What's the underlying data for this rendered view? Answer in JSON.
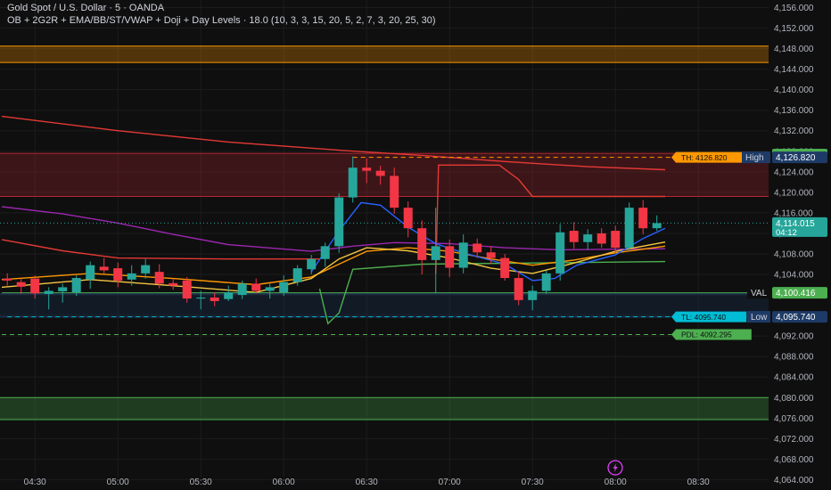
{
  "header": {
    "title": "Gold Spot / U.S. Dollar · 5 · OANDA",
    "indicators": "OB + 2G2R + EMA/BB/ST/VWAP + Doji + Day Levels · 18.0 (10, 3, 3, 15, 20, 5, 2, 7, 3, 20, 25, 30)"
  },
  "colors": {
    "background": "#0f0f0f",
    "bull": "#26a69a",
    "bear": "#f23645",
    "ema_blue": "#2962ff",
    "ema_yellow": "#f5c542",
    "ema_orange": "#ff9800",
    "purple": "#9c27b0",
    "zone_orange": "#ff9800",
    "zone_red": "#b22833",
    "zone_green": "#4caf50",
    "zone_blue": "#1e3a66",
    "supertrend_red": "#e53935",
    "supertrend_green": "#4caf50"
  },
  "chart_data": {
    "type": "candlestick",
    "symbol": "Gold Spot / U.S. Dollar",
    "interval": "5",
    "source": "OANDA",
    "y_axis": {
      "min": 4062,
      "max": 4157,
      "ticks": [
        4156,
        4152,
        4148,
        4144,
        4140,
        4136,
        4132,
        4128,
        4124,
        4120,
        4116,
        4112,
        4108,
        4104,
        4100,
        4096,
        4092,
        4088,
        4084,
        4080,
        4076,
        4072,
        4068,
        4064
      ]
    },
    "x_axis": {
      "labels": [
        {
          "label": "04:30",
          "t": 30
        },
        {
          "label": "05:00",
          "t": 60
        },
        {
          "label": "05:30",
          "t": 90
        },
        {
          "label": "06:00",
          "t": 120
        },
        {
          "label": "06:30",
          "t": 150
        },
        {
          "label": "07:00",
          "t": 180
        },
        {
          "label": "07:30",
          "t": 210
        },
        {
          "label": "08:00",
          "t": 240
        },
        {
          "label": "08:30",
          "t": 270
        }
      ],
      "t_range": [
        18,
        283
      ],
      "unit": "minutes after 04:00"
    },
    "candles": [
      {
        "t": 20,
        "o": 4103.2,
        "h": 4104.2,
        "l": 4101.8,
        "c": 4102.8
      },
      {
        "t": 25,
        "o": 4102.5,
        "h": 4103.2,
        "l": 4100.2,
        "c": 4101.6
      },
      {
        "t": 30,
        "o": 4103.2,
        "h": 4103.8,
        "l": 4099.3,
        "c": 4100.3
      },
      {
        "t": 35,
        "o": 4100.2,
        "h": 4101.5,
        "l": 4097.2,
        "c": 4100.8
      },
      {
        "t": 40,
        "o": 4100.7,
        "h": 4102.2,
        "l": 4098.5,
        "c": 4101.5
      },
      {
        "t": 45,
        "o": 4100.5,
        "h": 4103.8,
        "l": 4099.8,
        "c": 4103.3
      },
      {
        "t": 50,
        "o": 4103.0,
        "h": 4106.5,
        "l": 4101.2,
        "c": 4105.8
      },
      {
        "t": 55,
        "o": 4105.5,
        "h": 4107.2,
        "l": 4104.2,
        "c": 4104.8
      },
      {
        "t": 60,
        "o": 4105.2,
        "h": 4106.3,
        "l": 4101.5,
        "c": 4102.8
      },
      {
        "t": 65,
        "o": 4103.0,
        "h": 4105.8,
        "l": 4101.8,
        "c": 4104.2
      },
      {
        "t": 70,
        "o": 4104.2,
        "h": 4107.0,
        "l": 4103.2,
        "c": 4105.8
      },
      {
        "t": 75,
        "o": 4104.5,
        "h": 4106.0,
        "l": 4101.3,
        "c": 4102.2
      },
      {
        "t": 80,
        "o": 4102.3,
        "h": 4103.2,
        "l": 4101.0,
        "c": 4101.8
      },
      {
        "t": 85,
        "o": 4102.8,
        "h": 4103.5,
        "l": 4098.5,
        "c": 4099.3
      },
      {
        "t": 90,
        "o": 4099.3,
        "h": 4100.8,
        "l": 4097.2,
        "c": 4099.5
      },
      {
        "t": 95,
        "o": 4099.5,
        "h": 4100.5,
        "l": 4097.8,
        "c": 4098.8
      },
      {
        "t": 100,
        "o": 4099.2,
        "h": 4101.8,
        "l": 4098.8,
        "c": 4100.5
      },
      {
        "t": 105,
        "o": 4100.0,
        "h": 4102.8,
        "l": 4099.2,
        "c": 4102.2
      },
      {
        "t": 110,
        "o": 4102.2,
        "h": 4103.2,
        "l": 4100.3,
        "c": 4100.8
      },
      {
        "t": 115,
        "o": 4100.8,
        "h": 4102.2,
        "l": 4099.3,
        "c": 4101.5
      },
      {
        "t": 120,
        "o": 4100.5,
        "h": 4103.8,
        "l": 4099.8,
        "c": 4102.5
      },
      {
        "t": 125,
        "o": 4102.5,
        "h": 4105.8,
        "l": 4101.8,
        "c": 4105.2
      },
      {
        "t": 130,
        "o": 4105.0,
        "h": 4107.8,
        "l": 4104.0,
        "c": 4107.0
      },
      {
        "t": 135,
        "o": 4107.0,
        "h": 4110.2,
        "l": 4105.5,
        "c": 4109.5
      },
      {
        "t": 140,
        "o": 4109.5,
        "h": 4119.8,
        "l": 4108.2,
        "c": 4119.0
      },
      {
        "t": 145,
        "o": 4119.0,
        "h": 4127.0,
        "l": 4118.0,
        "c": 4124.8
      },
      {
        "t": 150,
        "o": 4124.8,
        "h": 4126.6,
        "l": 4121.8,
        "c": 4124.2
      },
      {
        "t": 155,
        "o": 4124.2,
        "h": 4125.2,
        "l": 4121.5,
        "c": 4123.2
      },
      {
        "t": 160,
        "o": 4123.2,
        "h": 4124.8,
        "l": 4115.8,
        "c": 4117.0
      },
      {
        "t": 165,
        "o": 4117.0,
        "h": 4118.2,
        "l": 4111.2,
        "c": 4113.0
      },
      {
        "t": 170,
        "o": 4113.0,
        "h": 4114.5,
        "l": 4104.0,
        "c": 4106.8
      },
      {
        "t": 175,
        "o": 4106.8,
        "h": 4117.0,
        "l": 4100.3,
        "c": 4109.5
      },
      {
        "t": 180,
        "o": 4109.5,
        "h": 4110.8,
        "l": 4103.5,
        "c": 4105.3
      },
      {
        "t": 185,
        "o": 4105.3,
        "h": 4111.8,
        "l": 4104.2,
        "c": 4110.2
      },
      {
        "t": 190,
        "o": 4110.0,
        "h": 4111.0,
        "l": 4107.2,
        "c": 4108.3
      },
      {
        "t": 195,
        "o": 4108.3,
        "h": 4109.5,
        "l": 4106.0,
        "c": 4107.2
      },
      {
        "t": 200,
        "o": 4107.2,
        "h": 4108.0,
        "l": 4102.8,
        "c": 4103.3
      },
      {
        "t": 205,
        "o": 4103.3,
        "h": 4104.5,
        "l": 4098.0,
        "c": 4099.0
      },
      {
        "t": 210,
        "o": 4099.0,
        "h": 4101.8,
        "l": 4097.0,
        "c": 4100.8
      },
      {
        "t": 215,
        "o": 4100.8,
        "h": 4104.8,
        "l": 4100.2,
        "c": 4104.2
      },
      {
        "t": 220,
        "o": 4104.2,
        "h": 4113.8,
        "l": 4102.8,
        "c": 4112.2
      },
      {
        "t": 225,
        "o": 4112.5,
        "h": 4114.2,
        "l": 4109.0,
        "c": 4110.3
      },
      {
        "t": 230,
        "o": 4110.3,
        "h": 4112.8,
        "l": 4108.8,
        "c": 4111.8
      },
      {
        "t": 235,
        "o": 4112.0,
        "h": 4113.0,
        "l": 4109.2,
        "c": 4110.0
      },
      {
        "t": 240,
        "o": 4112.5,
        "h": 4113.5,
        "l": 4108.2,
        "c": 4109.2
      },
      {
        "t": 245,
        "o": 4109.2,
        "h": 4118.0,
        "l": 4108.5,
        "c": 4117.0
      },
      {
        "t": 250,
        "o": 4117.0,
        "h": 4118.5,
        "l": 4111.8,
        "c": 4113.0
      },
      {
        "t": 255,
        "o": 4113.0,
        "h": 4115.5,
        "l": 4112.5,
        "c": 4114.0
      }
    ],
    "zones": [
      {
        "name": "orange-zone-top",
        "from": 4145.3,
        "to": 4148.5,
        "color": "#ff9800"
      },
      {
        "name": "red-zone",
        "from": 4119.2,
        "to": 4127.6,
        "color": "#b22833"
      },
      {
        "name": "blue-zone",
        "from": 4095.7,
        "to": 4100.2,
        "color": "#1e3a66"
      },
      {
        "name": "green-zone-bottom",
        "from": 4075.7,
        "to": 4080.0,
        "color": "#4caf50"
      }
    ],
    "levels": [
      {
        "name": "high-line",
        "value": 4126.82,
        "color": "#ff9800",
        "dashed": true,
        "t_start": 145,
        "label": "TH: 4126.820",
        "label_color": "#ff9800"
      },
      {
        "name": "tl-line",
        "value": 4095.74,
        "color": "#00bcd4",
        "dashed": true,
        "t_start": 20,
        "label": "TL: 4095.740",
        "label_color": "#00bcd4"
      },
      {
        "name": "pdl-line",
        "value": 4092.295,
        "color": "#4caf50",
        "dashed": true,
        "t_start": 18,
        "label": "PDL: 4092.295",
        "label_color": "#4caf50"
      },
      {
        "name": "val-line",
        "value": 4100.416,
        "color": "#4caf50",
        "dashed": false,
        "t_start": 18
      }
    ],
    "series": [
      {
        "name": "",
        "color": "#e53935",
        "points": [
          [
            18,
            4134.8
          ],
          [
            60,
            4132.0
          ],
          [
            100,
            4129.8
          ],
          [
            140,
            4128.2
          ],
          [
            170,
            4127.2
          ],
          [
            200,
            4126.0
          ],
          [
            230,
            4125.0
          ],
          [
            258,
            4124.4
          ]
        ]
      },
      {
        "name": "",
        "color": "#e53935",
        "points": [
          [
            175,
            4104.2
          ],
          [
            176,
            4125.3
          ],
          [
            198,
            4125.3
          ],
          [
            205,
            4122.5
          ],
          [
            210,
            4119.2
          ],
          [
            258,
            4119.2
          ]
        ]
      },
      {
        "name": "",
        "color": "#e53935",
        "points": [
          [
            18,
            4110.8
          ],
          [
            40,
            4108.6
          ],
          [
            60,
            4107.2
          ],
          [
            100,
            4107.0
          ],
          [
            133,
            4107.0
          ]
        ]
      },
      {
        "name": "",
        "color": "#4caf50",
        "points": [
          [
            133,
            4101.2
          ],
          [
            136,
            4094.4
          ],
          [
            140,
            4096.5
          ],
          [
            145,
            4105.0
          ],
          [
            170,
            4106.0
          ],
          [
            258,
            4106.5
          ]
        ]
      },
      {
        "name": "",
        "color": "#9c27b0",
        "points": [
          [
            18,
            4117.2
          ],
          [
            40,
            4115.8
          ],
          [
            60,
            4114.0
          ],
          [
            80,
            4111.8
          ],
          [
            100,
            4109.8
          ],
          [
            130,
            4108.5
          ],
          [
            145,
            4109.5
          ],
          [
            160,
            4110.2
          ],
          [
            180,
            4110.0
          ],
          [
            200,
            4109.2
          ],
          [
            220,
            4108.8
          ],
          [
            258,
            4109.0
          ]
        ]
      },
      {
        "name": "",
        "color": "#ff9800",
        "points": [
          [
            18,
            4103.0
          ],
          [
            50,
            4104.2
          ],
          [
            80,
            4103.2
          ],
          [
            110,
            4102.0
          ],
          [
            130,
            4103.5
          ],
          [
            140,
            4106.0
          ],
          [
            150,
            4108.5
          ],
          [
            165,
            4109.2
          ],
          [
            180,
            4108.5
          ],
          [
            195,
            4107.0
          ],
          [
            210,
            4105.8
          ],
          [
            225,
            4106.8
          ],
          [
            240,
            4108.2
          ],
          [
            258,
            4109.5
          ]
        ]
      },
      {
        "name": "",
        "color": "#f5c542",
        "points": [
          [
            18,
            4101.5
          ],
          [
            50,
            4103.0
          ],
          [
            80,
            4101.8
          ],
          [
            110,
            4100.5
          ],
          [
            130,
            4103.2
          ],
          [
            140,
            4107.0
          ],
          [
            150,
            4109.2
          ],
          [
            165,
            4108.6
          ],
          [
            180,
            4107.2
          ],
          [
            195,
            4105.2
          ],
          [
            210,
            4104.2
          ],
          [
            225,
            4106.2
          ],
          [
            240,
            4108.5
          ],
          [
            258,
            4110.3
          ]
        ]
      },
      {
        "name": "",
        "color": "#2962ff",
        "points": [
          [
            130,
            4104.5
          ],
          [
            140,
            4112.5
          ],
          [
            148,
            4118.0
          ],
          [
            155,
            4117.5
          ],
          [
            165,
            4113.2
          ],
          [
            175,
            4110.0
          ],
          [
            185,
            4108.2
          ],
          [
            200,
            4106.0
          ],
          [
            210,
            4102.8
          ],
          [
            218,
            4103.2
          ],
          [
            226,
            4105.8
          ],
          [
            240,
            4107.8
          ],
          [
            250,
            4111.0
          ],
          [
            258,
            4113.0
          ]
        ]
      }
    ],
    "price_labels": [
      {
        "name": "price-badge-last-alt",
        "text": "4,127.362",
        "value": 4127.362,
        "color": "#4caf50"
      },
      {
        "name": "price-badge-high",
        "text": "4,126.820",
        "tag": "High",
        "value": 4126.82,
        "color": "#1e3a66"
      },
      {
        "name": "price-badge-current",
        "text": "4,114.015",
        "sub": "04:12",
        "value": 4114.015,
        "color": "#26a69a"
      },
      {
        "name": "price-badge-val",
        "text": "4,100.416",
        "tag": "VAL",
        "value": 4100.416,
        "color": "#4caf50"
      },
      {
        "name": "price-badge-low",
        "text": "4,095.740",
        "tag": "Low",
        "value": 4095.74,
        "color": "#1e3a66"
      }
    ]
  }
}
